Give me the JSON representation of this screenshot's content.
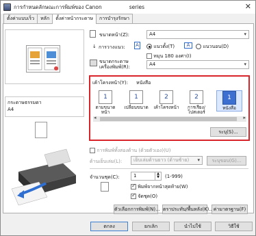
{
  "window": {
    "title": "การกำหนดลักษณะการพิมพ์ของ Canon",
    "title_suffix": "series",
    "close": "✕"
  },
  "tabs": [
    {
      "label": "ตั้งค่าแบบเร็ว"
    },
    {
      "label": "หลัก"
    },
    {
      "label": "ตั้งค่าหน้ากระดาษ"
    },
    {
      "label": "การบำรุงรักษา"
    }
  ],
  "preview": {
    "media_label": "กระดาษธรรมดา",
    "media_size": "A4"
  },
  "page_setup": {
    "page_size_label": "ขนาดหน้า(Z):",
    "page_size_value": "A4",
    "orientation_label": "การวางแนว:",
    "portrait_label": "แนวตั้ง(T)",
    "landscape_label": "แนวนอน(D)",
    "rotate_label": "หมุน 180 องศา(I)",
    "printer_paper_label": "ขนาดกระดาษเครื่องพิมพ์(R):",
    "printer_paper_value": "A4"
  },
  "layout": {
    "label": "เค้าโครงหน้า(Y):",
    "current": "หนังสือ",
    "items": [
      {
        "label": "ตามขนาดหน้า",
        "icon": "1"
      },
      {
        "label": "เปลี่ยนขนาด",
        "icon": "1"
      },
      {
        "label": "เค้าโครงหน้า",
        "icon": "2"
      },
      {
        "label": "การเรียง/โปสเตอร์",
        "icon": "2"
      },
      {
        "label": "หนังสือ",
        "icon": "1"
      }
    ],
    "specify_button": "ระบุ(S)..."
  },
  "duplex": {
    "checkbox_label": "การพิมพ์ทั้งสองด้าน (ด้วยตัวเอง)(U)",
    "binding_label": "ด้านเย็บเล่ม(L):",
    "binding_value": "เย็บเล่มด้านยาว (ด้านซ้าย)",
    "margin_button": "ระบุขอบ(G)..."
  },
  "copies": {
    "label": "จำนวนชุด(C):",
    "value": "1",
    "range": "(1-999)",
    "print_last_page_first": "พิมพ์จากหน้าสุดท้าย(W)",
    "collate": "จัดชุด(O)"
  },
  "bottom_buttons": {
    "print_options": "ตัวเลือกการพิมพ์(N)...",
    "stamp_background": "ตราประทับ/พื้นหลัง(K)...",
    "defaults": "ค่ามาตรฐาน(F)"
  },
  "dialog_buttons": {
    "ok": "ตกลง",
    "cancel": "ยกเลิก",
    "apply": "นำไปใช้",
    "help": "วิธีใช้"
  }
}
